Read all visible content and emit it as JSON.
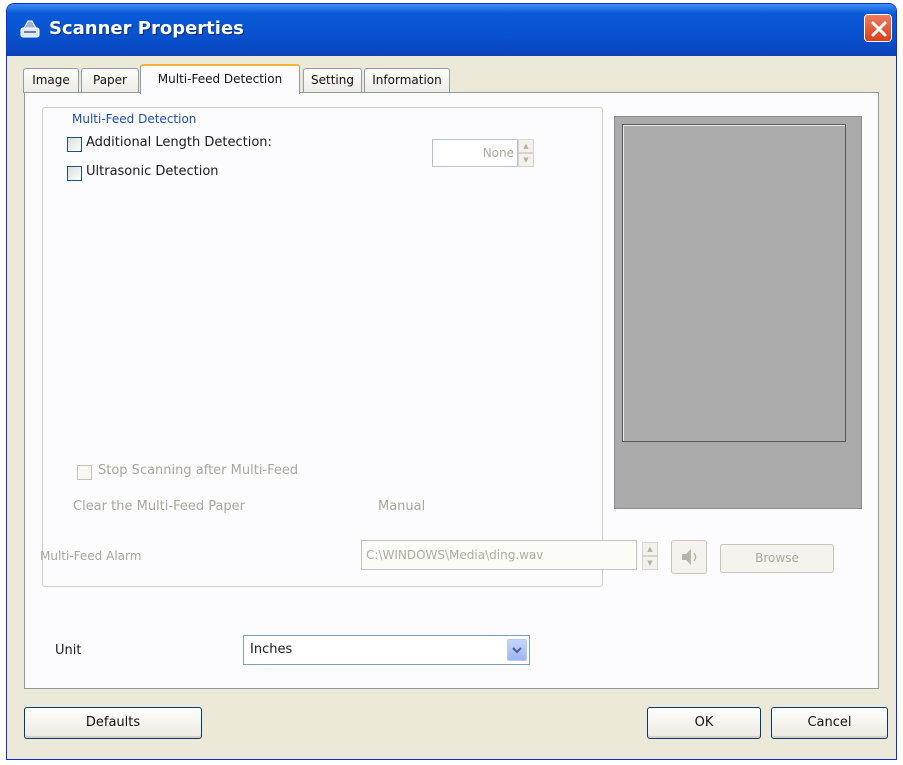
{
  "window": {
    "title": "Scanner Properties"
  },
  "tabs": [
    {
      "label": "Image",
      "active": false
    },
    {
      "label": "Paper",
      "active": false
    },
    {
      "label": "Multi-Feed Detection",
      "active": true
    },
    {
      "label": "Setting",
      "active": false
    },
    {
      "label": "Information",
      "active": false
    }
  ],
  "multifeed": {
    "group_label": "Multi-Feed Detection",
    "additional_length_label": "Additional Length Detection:",
    "additional_length_checked": false,
    "additional_length_value": "None",
    "ultrasonic_label": "Ultrasonic Detection",
    "ultrasonic_checked": false,
    "stop_scanning_label": "Stop Scanning after Multi-Feed",
    "stop_scanning_checked": false,
    "clear_paper_label": "Clear the Multi-Feed Paper",
    "clear_paper_value": "Manual",
    "alarm_label": "Multi-Feed Alarm",
    "alarm_path": "C:\\WINDOWS\\Media\\ding.wav",
    "browse_label": "Browse"
  },
  "unit": {
    "label": "Unit",
    "value": "Inches"
  },
  "buttons": {
    "defaults": "Defaults",
    "ok": "OK",
    "cancel": "Cancel"
  },
  "colors": {
    "title_bar": "#0853d0",
    "active_tab_accent": "#f4b437",
    "group_label": "#1c4fa8",
    "preview_bg": "#ababab"
  },
  "icons": {
    "title": "scanner-icon",
    "close": "close-icon",
    "speaker": "speaker-icon",
    "dropdown": "chevron-down-icon"
  }
}
